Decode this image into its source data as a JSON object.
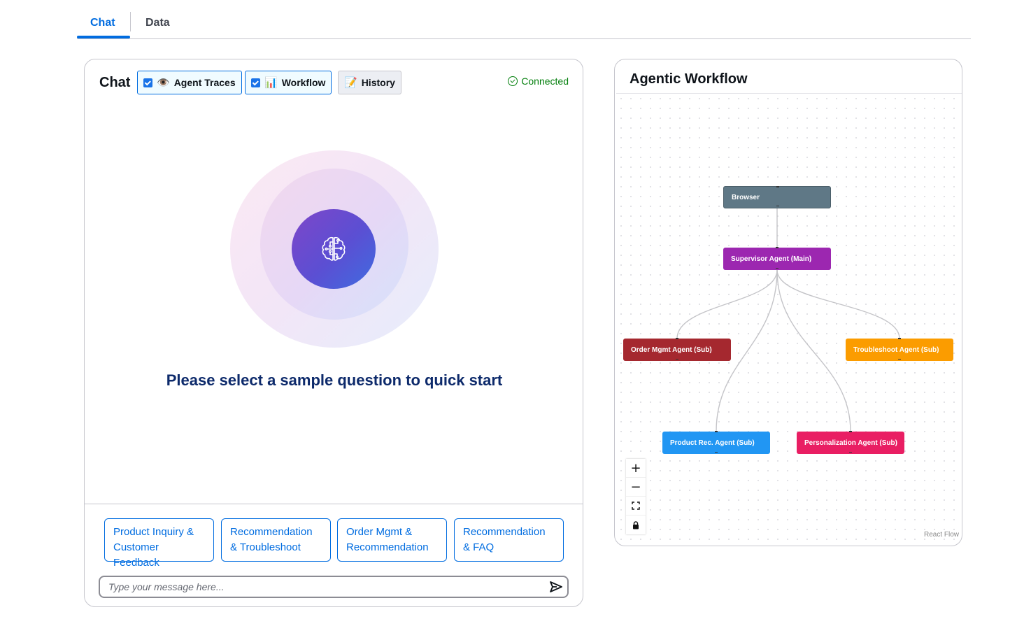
{
  "tabs": [
    {
      "label": "Chat",
      "active": true
    },
    {
      "label": "Data",
      "active": false
    }
  ],
  "chat": {
    "title": "Chat",
    "toggles": {
      "traces": {
        "emoji": "👁️",
        "label": "Agent Traces",
        "checked": true
      },
      "workflow": {
        "emoji": "📊",
        "label": "Workflow",
        "checked": true
      },
      "history": {
        "emoji": "📝",
        "label": "History",
        "checked": false
      }
    },
    "status": "Connected",
    "hero_text": "Please select a sample question to quick start",
    "sample_questions": [
      "Product Inquiry & Customer Feedback",
      "Recommendation & Troubleshoot",
      "Order Mgmt & Recommendation",
      "Recommendation & FAQ"
    ],
    "input_placeholder": "Type your message here..."
  },
  "workflow": {
    "title": "Agentic Workflow",
    "nodes": {
      "browser": "Browser",
      "supervisor": "Supervisor Agent (Main)",
      "order": "Order Mgmt Agent (Sub)",
      "troubleshoot": "Troubleshoot Agent (Sub)",
      "product": "Product Rec. Agent (Sub)",
      "personalization": "Personalization Agent (Sub)"
    },
    "attribution": "React Flow"
  },
  "colors": {
    "accent": "#006ce0",
    "status_ok": "#037f0c",
    "browser": "#5f7886",
    "supervisor": "#9c27b0",
    "order": "#a5282f",
    "troubleshoot": "#fb9c00",
    "product": "#2196f3",
    "personalization": "#e91e63"
  },
  "icons": [
    "brain-circuit-icon",
    "send-icon",
    "check-circle-icon",
    "zoom-in-icon",
    "zoom-out-icon",
    "fit-view-icon",
    "lock-icon"
  ]
}
